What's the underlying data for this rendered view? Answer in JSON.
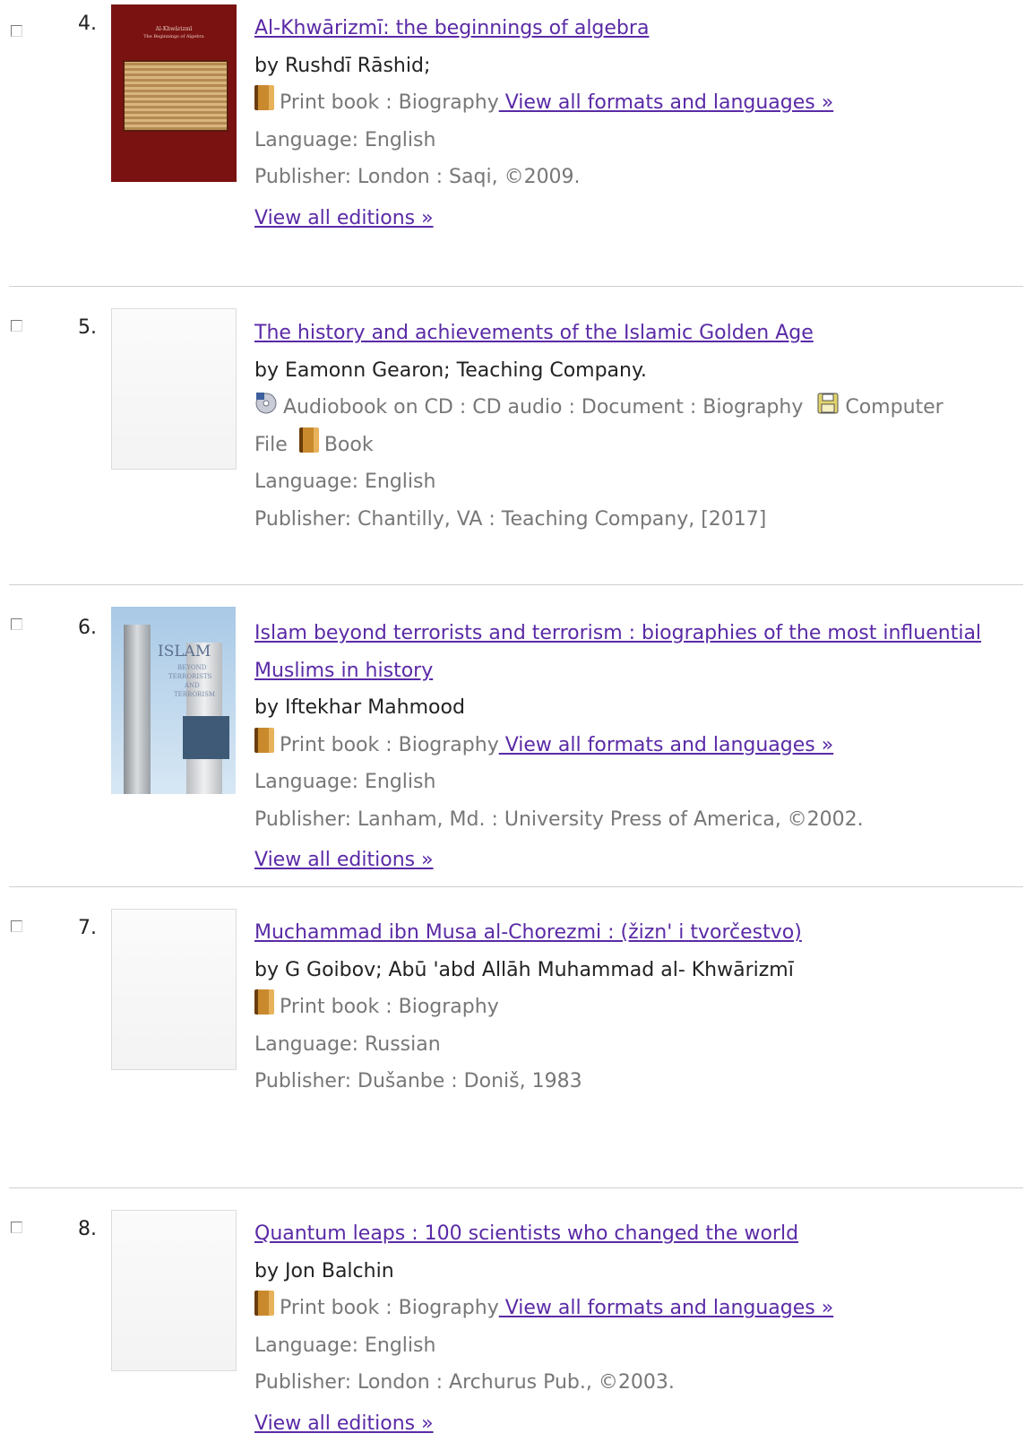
{
  "records": [
    {
      "number": "4.",
      "title": "Al-Khwārizmī: the beginnings of algebra",
      "by": "by Rushdī Rāshid;",
      "format": "Print book : Biography",
      "formats_link": " View all formats and languages »",
      "language": "Language: English",
      "publisher": "Publisher: London : Saqi, ©2009.",
      "editions_link": "View all editions »",
      "cover": {
        "title": "Al-Khwārizmī",
        "subtitle": "The Beginnings of Algebra"
      }
    },
    {
      "number": "5.",
      "title": "The history and achievements of the Islamic Golden Age",
      "by": "by Eamonn Gearon; Teaching Company.",
      "format_a": "Audiobook on CD : CD audio : Document : Biography",
      "format_b1": "Computer",
      "format_b2": "File",
      "format_c": "Book",
      "language": "Language: English",
      "publisher": "Publisher: Chantilly, VA : Teaching Company, [2017]"
    },
    {
      "number": "6.",
      "title_line1": "Islam beyond terrorists and terrorism : biographies of the most influential",
      "title_line2": "Muslims in history",
      "by": "by Iftekhar Mahmood",
      "format": "Print book : Biography",
      "formats_link": " View all formats and languages »",
      "language": "Language: English",
      "publisher": "Publisher: Lanham, Md. : University Press of America, ©2002.",
      "editions_link": "View all editions »",
      "cover": {
        "word1": "ISLAM",
        "word2": "BEYOND",
        "word3": "TERRORISTS",
        "word4": "AND",
        "word5": "TERRORISM"
      }
    },
    {
      "number": "7.",
      "title": "Muchammad ibn Musa al-Chorezmi : (žizn' i tvorčestvo)",
      "by": "by G Goibov; Abū 'abd Allāh Muhammad al- Khwārizmī",
      "format": "Print book : Biography",
      "language": "Language: Russian",
      "publisher": "Publisher: Dušanbe : Doniš, 1983"
    },
    {
      "number": "8.",
      "title": "Quantum leaps : 100 scientists who changed the world",
      "by": "by Jon Balchin",
      "format": "Print book : Biography",
      "formats_link": " View all formats and languages »",
      "language": "Language: English",
      "publisher": "Publisher: London : Archurus Pub., ©2003.",
      "editions_link": "View all editions »"
    }
  ]
}
